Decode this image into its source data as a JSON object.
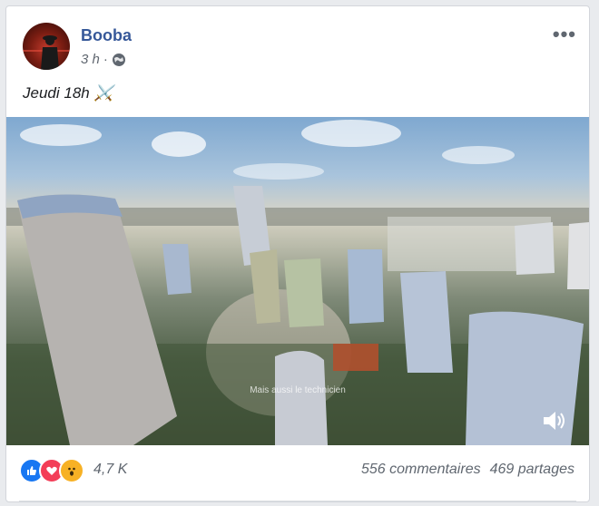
{
  "post": {
    "author": "Booba",
    "time": "3 h",
    "separator": "·",
    "caption": "Jeudi 18h ⚔️",
    "more_label": "•••"
  },
  "video": {
    "overlay_text": "Mais aussi le technicien"
  },
  "reactions": {
    "icons": [
      "like-icon",
      "love-icon",
      "wow-icon"
    ],
    "count": "4,7 K"
  },
  "stats": {
    "comments": "556 commentaires",
    "shares": "469 partages"
  },
  "colors": {
    "author": "#365899",
    "like": "#1877f2",
    "love": "#f33e58",
    "wow": "#f7b125"
  }
}
